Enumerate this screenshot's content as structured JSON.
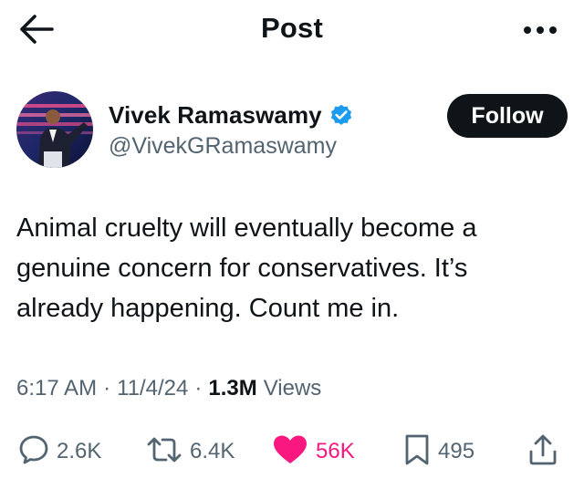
{
  "header": {
    "title": "Post",
    "back_icon": "arrow-left-icon",
    "more_icon": "more-horizontal-icon"
  },
  "author": {
    "name": "Vivek Ramaswamy",
    "handle": "@VivekGRamaswamy",
    "verified_icon": "verified-badge-icon",
    "verified_color": "#1d9bf0",
    "follow_label": "Follow"
  },
  "post": {
    "text_lines": [
      "Animal cruelty will eventually become a",
      "genuine concern for conservatives. It’s",
      "already happening. Count me in."
    ]
  },
  "meta": {
    "time": "6:17 AM",
    "separator": "·",
    "date": "11/4/24",
    "views_count": "1.3M",
    "views_label": "Views"
  },
  "actions": {
    "replies": "2.6K",
    "reposts": "6.4K",
    "likes": "56K",
    "bookmarks": "495",
    "like_color": "#f91880",
    "icons": [
      "reply-icon",
      "repost-icon",
      "heart-icon",
      "bookmark-icon",
      "share-icon"
    ]
  },
  "colors": {
    "text": "#0f1419",
    "secondary": "#536471",
    "follow_bg": "#0f1419"
  }
}
